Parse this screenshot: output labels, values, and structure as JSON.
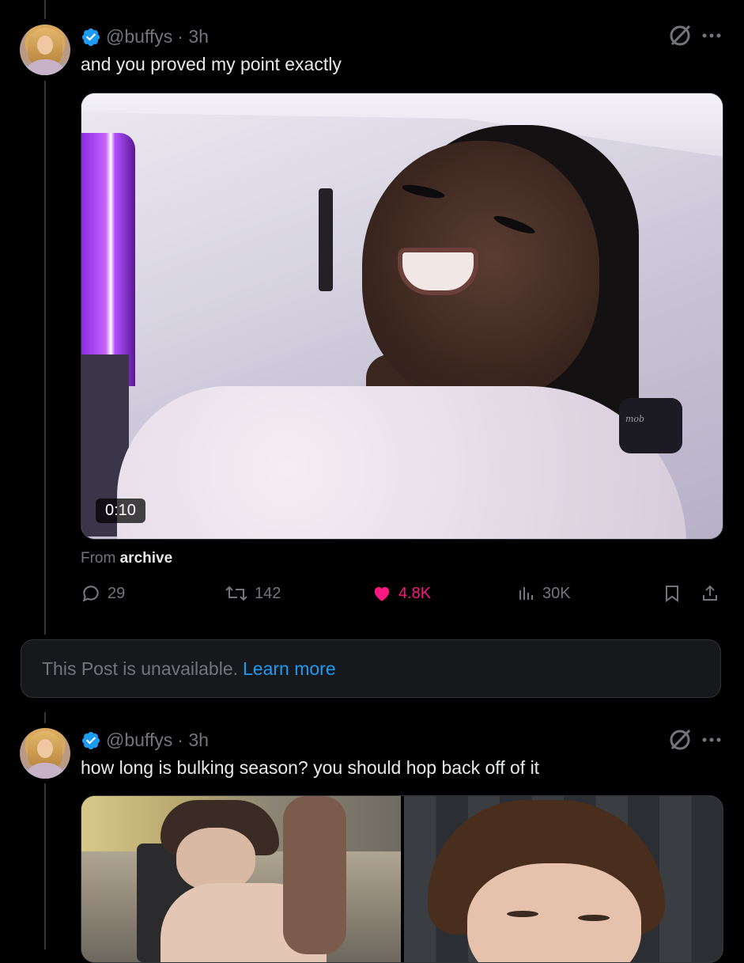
{
  "posts": [
    {
      "handle": "@buffys",
      "time": "· 3h",
      "text": "and you proved my point exactly",
      "media": {
        "type": "video",
        "duration": "0:10",
        "watermark": "mob"
      },
      "from_prefix": "From",
      "from_source": "archive",
      "stats": {
        "replies": "29",
        "reposts": "142",
        "likes": "4.8K",
        "views": "30K"
      }
    },
    {
      "handle": "@buffys",
      "time": "· 3h",
      "text": "how long is bulking season? you should hop back off of it"
    }
  ],
  "unavailable_notice": {
    "text": "This Post is unavailable.",
    "link": "Learn more"
  },
  "colors": {
    "background": "#000000",
    "text_primary": "#e7e9ea",
    "text_secondary": "#71767b",
    "like": "#f91880",
    "link": "#1d9bf0",
    "verified": "#1d9bf0"
  }
}
